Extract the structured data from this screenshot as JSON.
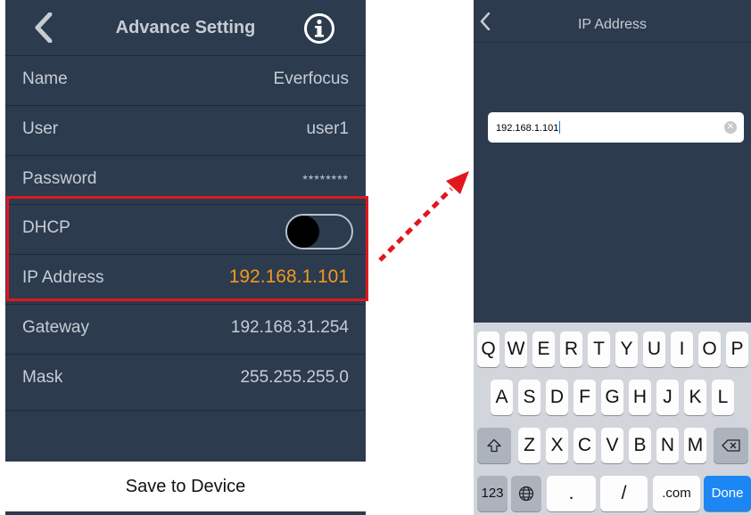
{
  "left_screen": {
    "nav": {
      "title": "Advance Setting"
    },
    "rows": [
      {
        "label": "Name",
        "value": "Everfocus"
      },
      {
        "label": "User",
        "value": "user1"
      },
      {
        "label": "Password",
        "value": "********"
      },
      {
        "label": "DHCP",
        "toggle": "off"
      },
      {
        "label": "IP Address",
        "value": "192.168.1.101"
      },
      {
        "label": "Gateway",
        "value": "192.168.31.254"
      },
      {
        "label": "Mask",
        "value": "255.255.255.0"
      }
    ],
    "save_button": "Save to Device"
  },
  "right_screen": {
    "nav": {
      "title": "IP Address"
    },
    "ip_input": {
      "value": "192.168.1.101"
    },
    "keyboard": {
      "row1": [
        "Q",
        "W",
        "E",
        "R",
        "T",
        "Y",
        "U",
        "I",
        "O",
        "P"
      ],
      "row2": [
        "A",
        "S",
        "D",
        "F",
        "G",
        "H",
        "J",
        "K",
        "L"
      ],
      "row3": [
        "Z",
        "X",
        "C",
        "V",
        "B",
        "N",
        "M"
      ],
      "row4": {
        "numbers": "123",
        "dot": ".",
        "slash": "/",
        "dotcom": ".com",
        "done": "Done"
      }
    }
  },
  "colors": {
    "background": "#2c3b4e",
    "highlight_box": "#e3161c",
    "ip_value": "#f39a1c",
    "done_key": "#1d86f5"
  },
  "icons": [
    "chevron-left-icon",
    "info-icon",
    "clear-icon",
    "globe-icon",
    "shift-icon",
    "backspace-icon"
  ]
}
